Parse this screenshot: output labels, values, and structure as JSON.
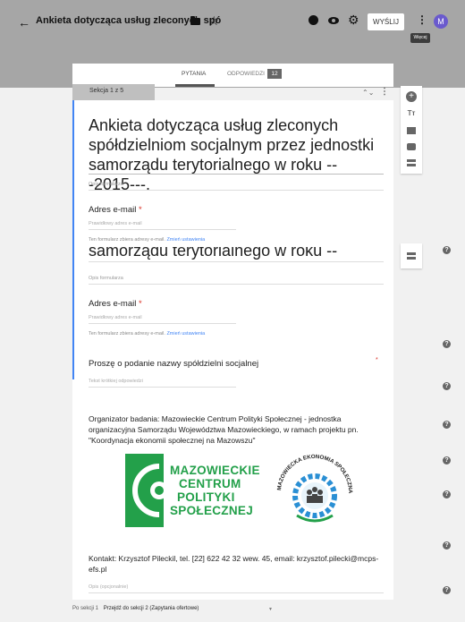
{
  "header": {
    "back_icon": "arrow-left-icon",
    "title": "Ankieta dotycząca usług zleconych spó",
    "send_label": "WYŚLIJ",
    "avatar_letter": "M",
    "tooltip": "Więcej"
  },
  "tabs": {
    "questions": "PYTANIA",
    "responses": "ODPOWIEDZI",
    "responses_count": "12"
  },
  "section": {
    "label": "Sekcja 1 z 5"
  },
  "form": {
    "title": "Ankieta dotycząca usług zleconych spółdzielniom socjalnym przez jednostki samorządu terytorialnego w roku ---2015---.",
    "title_fragment": "samorządu terytorialnego w roku ---2015---.",
    "description_placeholder": "Opis formularza",
    "email_label": "Adres e-mail",
    "email_required": "*",
    "email_placeholder": "Prawidłowy adres e-mail",
    "email_note": "Ten formularz zbiera adresy e-mail.",
    "email_note_link": "Zmień ustawienia",
    "question_label": "Proszę o podanie nazwy spółdzielni socjalnej",
    "question_required": "*",
    "short_answer_placeholder": "Tekst krótkiej odpowiedzi",
    "organizer_text": "Organizator badania: Mazowieckie Centrum Polityki Społecznej - jednostka organizacyjna Samorządu Województwa Mazowieckiego, w ramach projektu pn. \"Koordynacja ekonomii społecznej na Mazowszu\"",
    "logo_mcps_lines": [
      "MAZOWIECKIE",
      "CENTRUM",
      "POLITYKI",
      "SPOŁECZNEJ"
    ],
    "logo_mes_text": "MAZOWIECKA EKONOMIA SPOŁECZNA",
    "contact_text": "Kontakt: Krzysztof Pileckil, tel. [22] 622 42 32 wew. 45, email: krzysztof.pilecki@mcps-efs.pl",
    "optional_placeholder": "Opis (opcjonalnie)"
  },
  "footer": {
    "after_section": "Po sekcji 1",
    "goto": "Przejdź do sekcji 2 (Zapytania ofertowe)"
  },
  "colors": {
    "accent": "#4285f4",
    "brand_green": "#23a04a",
    "required": "#d93025"
  }
}
